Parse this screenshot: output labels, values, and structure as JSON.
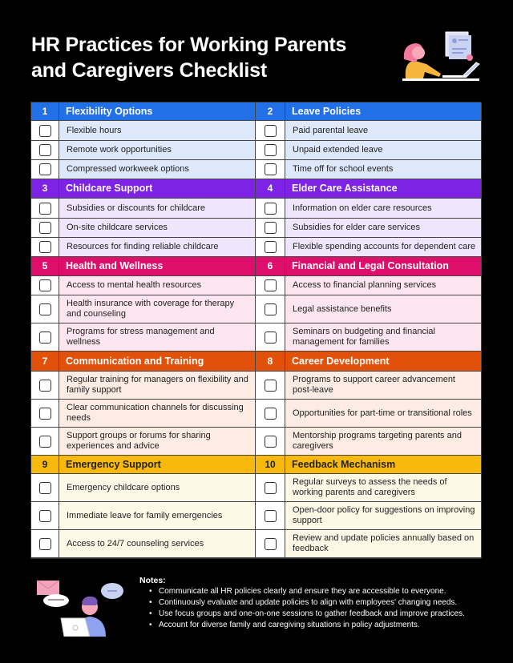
{
  "title": "HR Practices for Working Parents and Caregivers Checklist",
  "icons": {
    "hero": "woman-at-laptop-illustration",
    "footer": "man-at-laptop-chat-illustration",
    "checkbox": "checkbox-icon"
  },
  "colors": {
    "blue": "#2170e8",
    "blue_light": "#dde8fb",
    "purple": "#7e22e6",
    "purple_light": "#efe6fc",
    "pink": "#de0f6c",
    "pink_light": "#fde6ef",
    "orange": "#e2510a",
    "orange_light": "#fdece3",
    "yellow": "#f8b90c",
    "yellow_light": "#fef8e6"
  },
  "bands": [
    {
      "color": "blue",
      "left": {
        "num": "1",
        "title": "Flexibility Options",
        "items": [
          "Flexible hours",
          "Remote work opportunities",
          "Compressed workweek options"
        ]
      },
      "right": {
        "num": "2",
        "title": "Leave Policies",
        "items": [
          "Paid parental leave",
          "Unpaid extended leave",
          "Time off for school events"
        ]
      }
    },
    {
      "color": "purple",
      "left": {
        "num": "3",
        "title": "Childcare Support",
        "items": [
          "Subsidies or discounts for childcare",
          "On-site childcare services",
          "Resources for finding reliable childcare"
        ]
      },
      "right": {
        "num": "4",
        "title": "Elder Care Assistance",
        "items": [
          "Information on elder care resources",
          "Subsidies for elder care services",
          "Flexible spending accounts for dependent care"
        ]
      }
    },
    {
      "color": "pink",
      "left": {
        "num": "5",
        "title": "Health and Wellness",
        "items": [
          "Access to mental health resources",
          "Health insurance with coverage for therapy and counseling",
          "Programs for stress management and wellness"
        ]
      },
      "right": {
        "num": "6",
        "title": "Financial and Legal Consultation",
        "items": [
          "Access to financial planning services",
          "Legal assistance benefits",
          "Seminars on budgeting and financial management for families"
        ]
      }
    },
    {
      "color": "orange",
      "left": {
        "num": "7",
        "title": "Communication and Training",
        "items": [
          "Regular training for managers on flexibility and family support",
          "Clear communication channels for discussing needs",
          "Support groups or forums for sharing experiences and advice"
        ]
      },
      "right": {
        "num": "8",
        "title": "Career Development",
        "items": [
          "Programs to support career advancement post-leave",
          "Opportunities for part-time or transitional roles",
          "Mentorship programs targeting parents and caregivers"
        ]
      }
    },
    {
      "color": "yellow",
      "left": {
        "num": "9",
        "title": "Emergency Support",
        "items": [
          "Emergency childcare options",
          "Immediate leave for family emergencies",
          "Access to 24/7 counseling services"
        ]
      },
      "right": {
        "num": "10",
        "title": "Feedback Mechanism",
        "items": [
          "Regular surveys to assess the needs of working parents and caregivers",
          "Open-door policy for suggestions on improving support",
          "Review and update policies annually based on feedback"
        ]
      }
    }
  ],
  "notes": {
    "title": "Notes:",
    "items": [
      "Communicate all HR policies clearly and ensure they are accessible to everyone.",
      "Continuously evaluate and update policies to align with employees' changing needs.",
      "Use focus groups and one-on-one sessions to gather feedback and improve practices.",
      "Account for diverse family and caregiving situations in policy adjustments."
    ]
  }
}
